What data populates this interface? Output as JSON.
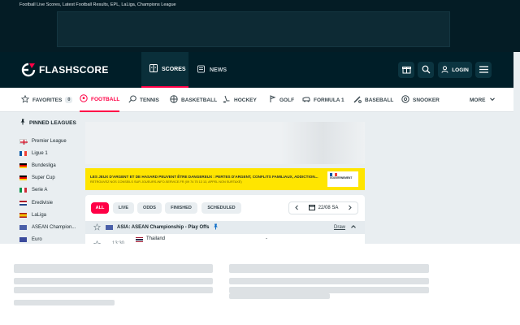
{
  "seo_title": "Football Live Scores, Latest Football Results, EPL, LaLiga, Champions League",
  "brand": "FLASHSCORE",
  "header": {
    "tabs": [
      {
        "label": "SCORES",
        "icon": "scoreboard-icon"
      },
      {
        "label": "NEWS",
        "icon": "newspaper-icon"
      }
    ],
    "login_label": "LOGIN"
  },
  "sports_nav": [
    {
      "label": "FAVORITES",
      "count": "0",
      "icon": "star-icon"
    },
    {
      "label": "FOOTBALL",
      "icon": "football-icon"
    },
    {
      "label": "TENNIS",
      "icon": "tennis-icon"
    },
    {
      "label": "BASKETBALL",
      "icon": "basketball-icon"
    },
    {
      "label": "HOCKEY",
      "icon": "hockey-icon"
    },
    {
      "label": "GOLF",
      "icon": "golf-icon"
    },
    {
      "label": "FORMULA 1",
      "icon": "formula1-icon"
    },
    {
      "label": "BASEBALL",
      "icon": "baseball-icon"
    },
    {
      "label": "SNOOKER",
      "icon": "snooker-icon"
    },
    {
      "label": "MORE",
      "icon": "chevron-down-icon"
    }
  ],
  "sidebar": {
    "title": "PINNED LEAGUES",
    "leagues": [
      {
        "label": "Premier League",
        "flag": "england"
      },
      {
        "label": "Ligue 1",
        "flag": "france"
      },
      {
        "label": "Bundesliga",
        "flag": "germany"
      },
      {
        "label": "Super Cup",
        "flag": "germany"
      },
      {
        "label": "Serie A",
        "flag": "italy"
      },
      {
        "label": "Eredivisie",
        "flag": "netherlands"
      },
      {
        "label": "LaLiga",
        "flag": "spain"
      },
      {
        "label": "ASEAN Champion...",
        "flag": "asia"
      },
      {
        "label": "Euro",
        "flag": "europe"
      }
    ]
  },
  "gamble_notice": {
    "headline": "LES JEUX D'ARGENT ET DE HASARD PEUVENT ÊTRE DANGEREUX : PERTES D'ARGENT, CONFLITS FAMILIAUX, ADDICTION...",
    "subline": "RETROUVEZ NOS CONSEILS SUR JOUEURS-INFO-SERVICE.FR (09 74 75 13 13, APPEL NON SURTAXÉ)",
    "gov_label": "GOUVERNEMENT"
  },
  "filters": [
    "ALL",
    "LIVE",
    "ODDS",
    "FINISHED",
    "SCHEDULED"
  ],
  "date_label": "22/08 SA",
  "league_header": {
    "label": "ASIA: ASEAN Championship - Play Offs",
    "draw_label": "Draw"
  },
  "match": {
    "time": "13:30",
    "home": "Thailand",
    "score": "-"
  },
  "colors": {
    "accent": "#ff0046",
    "header_bg": "#001e28",
    "banner_bg": "#041c25",
    "gamble_bg": "#ffe500"
  }
}
